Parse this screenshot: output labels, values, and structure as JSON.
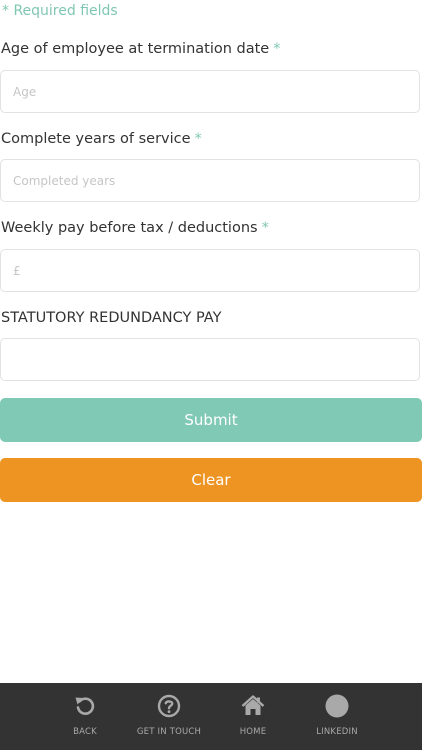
{
  "form": {
    "required_note": "* Required fields",
    "age": {
      "label": "Age of employee at termination date",
      "required_mark": "*",
      "placeholder": "Age",
      "value": ""
    },
    "years": {
      "label": "Complete years of service",
      "required_mark": "*",
      "placeholder": "Completed years",
      "value": ""
    },
    "weekly_pay": {
      "label": "Weekly pay before tax / deductions",
      "required_mark": "*",
      "placeholder": "£",
      "value": ""
    },
    "result": {
      "label": "STATUTORY REDUNDANCY PAY",
      "value": ""
    },
    "submit_label": "Submit",
    "clear_label": "Clear"
  },
  "nav": {
    "items": [
      {
        "label": "BACK",
        "icon": "undo-icon"
      },
      {
        "label": "GET IN TOUCH",
        "icon": "question-circle-icon"
      },
      {
        "label": "HOME",
        "icon": "home-icon"
      },
      {
        "label": "LINKEDIN",
        "icon": "linkedin-icon"
      }
    ]
  },
  "colors": {
    "accent": "#80c9b4",
    "clear": "#ee9422",
    "nav_background": "#333333",
    "nav_text": "#a9a9a9"
  }
}
